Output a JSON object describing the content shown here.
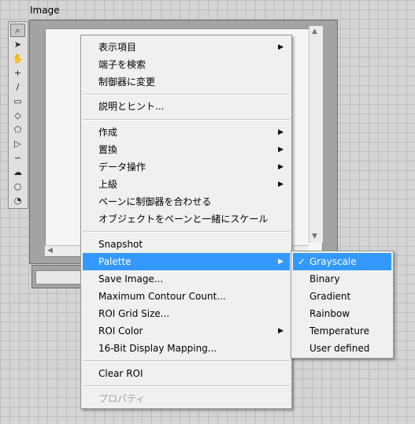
{
  "window": {
    "label": "Image"
  },
  "toolbar": {
    "tools": [
      {
        "icon": "zoom-icon",
        "glyph": "⌕"
      },
      {
        "icon": "pointer-icon",
        "glyph": "➤"
      },
      {
        "icon": "pan-hand-icon",
        "glyph": "✋"
      },
      {
        "icon": "crosshair-icon",
        "glyph": "+"
      },
      {
        "icon": "line-icon",
        "glyph": "/"
      },
      {
        "icon": "rectangle-icon",
        "glyph": "▭"
      },
      {
        "icon": "rotated-rectangle-icon",
        "glyph": "◇"
      },
      {
        "icon": "annulus-icon",
        "glyph": "⬠"
      },
      {
        "icon": "polygon-icon",
        "glyph": "▷"
      },
      {
        "icon": "freehand-line-icon",
        "glyph": "∽"
      },
      {
        "icon": "freehand-region-icon",
        "glyph": "☁"
      },
      {
        "icon": "oval-icon",
        "glyph": "○"
      },
      {
        "icon": "annulus-arc-icon",
        "glyph": "◔"
      }
    ]
  },
  "menu": {
    "items": [
      {
        "label": "表示項目",
        "submenu": true
      },
      {
        "label": "端子を検索"
      },
      {
        "label": "制御器に変更"
      },
      {
        "label": "説明とヒント..."
      },
      {
        "label": "作成",
        "submenu": true
      },
      {
        "label": "置換",
        "submenu": true
      },
      {
        "label": "データ操作",
        "submenu": true
      },
      {
        "label": "上級",
        "submenu": true
      },
      {
        "label": "ペーンに制御器を合わせる"
      },
      {
        "label": "オブジェクトをペーンと一緒にスケール"
      },
      {
        "label": "Snapshot"
      },
      {
        "label": "Palette",
        "submenu": true,
        "highlighted": true
      },
      {
        "label": "Save Image..."
      },
      {
        "label": "Maximum Contour Count..."
      },
      {
        "label": "ROI Grid Size..."
      },
      {
        "label": "ROI Color",
        "submenu": true
      },
      {
        "label": "16-Bit Display Mapping..."
      },
      {
        "label": "Clear ROI"
      },
      {
        "label": "プロパティ",
        "disabled": true
      }
    ]
  },
  "palette_submenu": {
    "items": [
      {
        "label": "Grayscale",
        "checked": true,
        "check": "✓"
      },
      {
        "label": "Binary"
      },
      {
        "label": "Gradient"
      },
      {
        "label": "Rainbow"
      },
      {
        "label": "Temperature"
      },
      {
        "label": "User defined"
      }
    ]
  },
  "glyphs": {
    "submenu_arrow": "▶",
    "scroll_up": "▲",
    "scroll_down": "▼",
    "scroll_left": "◀",
    "scroll_right": "▶"
  },
  "colors": {
    "highlight": "#3399ff",
    "menu_bg": "#f0f0f0",
    "disabled_text": "#a0a0a0"
  }
}
